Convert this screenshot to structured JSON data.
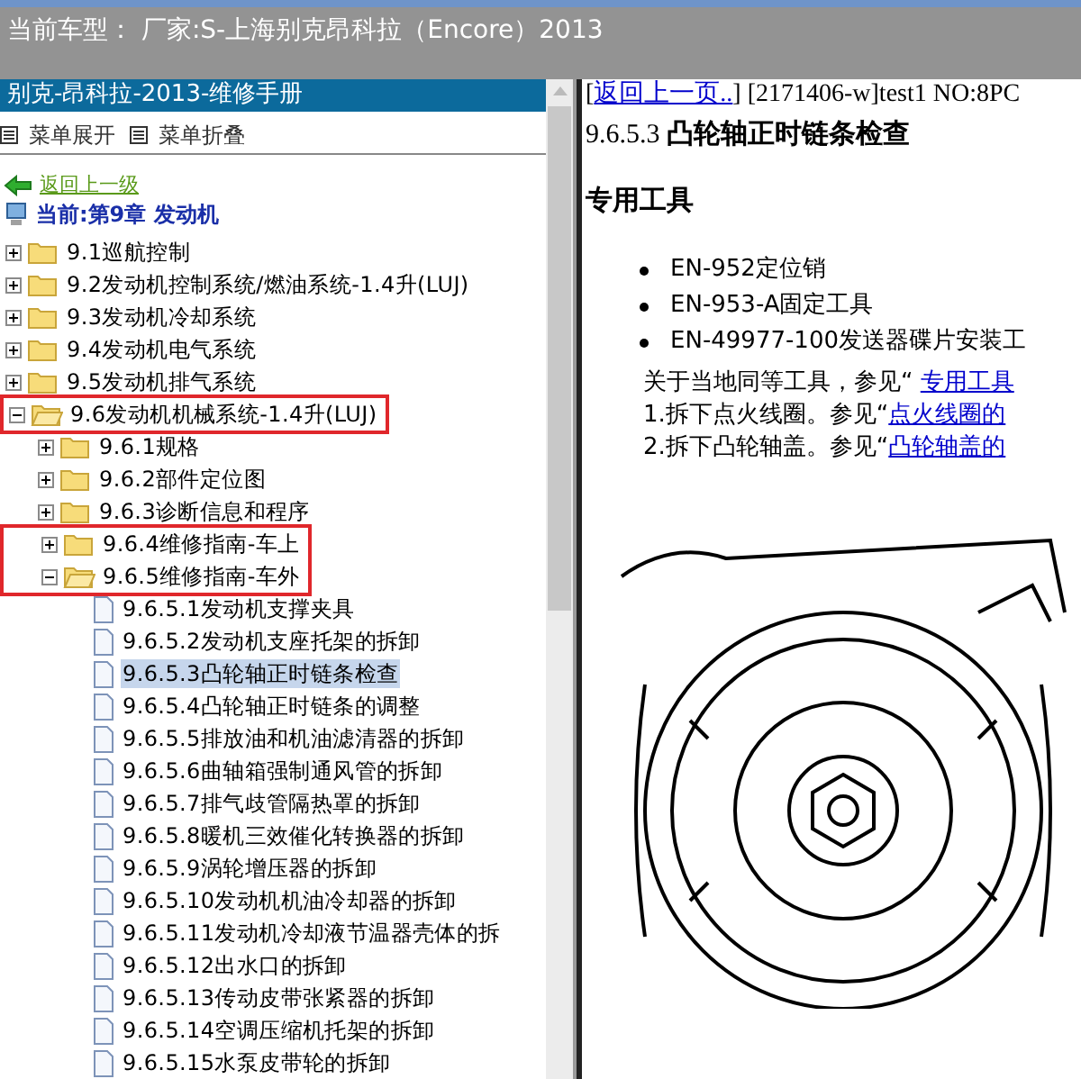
{
  "header": {
    "title": "当前车型： 厂家:S-上海别克昂科拉（Encore）2013"
  },
  "left_panel": {
    "title": "别克-昂科拉-2013-维修手册",
    "toolbar": [
      {
        "label": "菜单展开"
      },
      {
        "label": "菜单折叠"
      }
    ],
    "back_link": "返回上一级",
    "current": "当前:第9章 发动机",
    "tree": [
      {
        "label": "9.1巡航控制",
        "kind": "folder",
        "expanded": false,
        "selected": false,
        "boxed": false
      },
      {
        "label": "9.2发动机控制系统/燃油系统-1.4升(LUJ)",
        "kind": "folder",
        "expanded": false,
        "selected": false,
        "boxed": false
      },
      {
        "label": "9.3发动机冷却系统",
        "kind": "folder",
        "expanded": false,
        "selected": false,
        "boxed": false
      },
      {
        "label": "9.4发动机电气系统",
        "kind": "folder",
        "expanded": false,
        "selected": false,
        "boxed": false
      },
      {
        "label": "9.5发动机排气系统",
        "kind": "folder",
        "expanded": false,
        "selected": false,
        "boxed": false
      },
      {
        "label": "9.6发动机机械系统-1.4升(LUJ)",
        "kind": "folder",
        "expanded": true,
        "selected": false,
        "boxed": true,
        "children": [
          {
            "label": "9.6.1规格",
            "kind": "folder",
            "expanded": false,
            "selected": false,
            "boxed": false
          },
          {
            "label": "9.6.2部件定位图",
            "kind": "folder",
            "expanded": false,
            "selected": false,
            "boxed": false
          },
          {
            "label": "9.6.3诊断信息和程序",
            "kind": "folder",
            "expanded": false,
            "selected": false,
            "boxed": false
          },
          {
            "label": "9.6.4维修指南-车上",
            "kind": "folder",
            "expanded": false,
            "selected": false,
            "boxed": true
          },
          {
            "label": "9.6.5维修指南-车外",
            "kind": "folder",
            "expanded": true,
            "selected": false,
            "boxed": true,
            "children": [
              {
                "label": "9.6.5.1发动机支撑夹具",
                "kind": "page",
                "selected": false,
                "boxed": false
              },
              {
                "label": "9.6.5.2发动机支座托架的拆卸",
                "kind": "page",
                "selected": false,
                "boxed": false
              },
              {
                "label": "9.6.5.3凸轮轴正时链条检查",
                "kind": "page",
                "selected": true,
                "boxed": false
              },
              {
                "label": "9.6.5.4凸轮轴正时链条的调整",
                "kind": "page",
                "selected": false,
                "boxed": false
              },
              {
                "label": "9.6.5.5排放油和机油滤清器的拆卸",
                "kind": "page",
                "selected": false,
                "boxed": false
              },
              {
                "label": "9.6.5.6曲轴箱强制通风管的拆卸",
                "kind": "page",
                "selected": false,
                "boxed": false
              },
              {
                "label": "9.6.5.7排气歧管隔热罩的拆卸",
                "kind": "page",
                "selected": false,
                "boxed": false
              },
              {
                "label": "9.6.5.8暖机三效催化转换器的拆卸",
                "kind": "page",
                "selected": false,
                "boxed": false
              },
              {
                "label": "9.6.5.9涡轮增压器的拆卸",
                "kind": "page",
                "selected": false,
                "boxed": false
              },
              {
                "label": "9.6.5.10发动机机油冷却器的拆卸",
                "kind": "page",
                "selected": false,
                "boxed": false
              },
              {
                "label": "9.6.5.11发动机冷却液节温器壳体的拆",
                "kind": "page",
                "selected": false,
                "boxed": false
              },
              {
                "label": "9.6.5.12出水口的拆卸",
                "kind": "page",
                "selected": false,
                "boxed": false
              },
              {
                "label": "9.6.5.13传动皮带张紧器的拆卸",
                "kind": "page",
                "selected": false,
                "boxed": false
              },
              {
                "label": "9.6.5.14空调压缩机托架的拆卸",
                "kind": "page",
                "selected": false,
                "boxed": false
              },
              {
                "label": "9.6.5.15水泵皮带轮的拆卸",
                "kind": "page",
                "selected": false,
                "boxed": false
              }
            ]
          }
        ]
      }
    ]
  },
  "content": {
    "nav": [
      {
        "kind": "text",
        "text": "["
      },
      {
        "kind": "link",
        "text": "返回上一页.."
      },
      {
        "kind": "text",
        "text": "] [2171406-w]test1 NO:8PC"
      }
    ],
    "heading": "9.6.5.3 **凸轮轴正时链条检查**",
    "section": "专用工具",
    "bullets": [
      "EN-952定位销",
      "EN-953-A固定工具",
      "EN-49977-100发送器碟片安装工"
    ],
    "paragraphs": [
      [
        {
          "kind": "text",
          "text": "关于当地同等工具，参见“ "
        },
        {
          "kind": "link",
          "text": "专用工具"
        }
      ],
      [
        {
          "kind": "text",
          "text": "1.拆下点火线圈。参见“"
        },
        {
          "kind": "link",
          "text": "点火线圈的"
        }
      ],
      [
        {
          "kind": "text",
          "text": "2.拆下凸轮轴盖。参见“"
        },
        {
          "kind": "link",
          "text": "凸轮轴盖的"
        }
      ]
    ]
  }
}
